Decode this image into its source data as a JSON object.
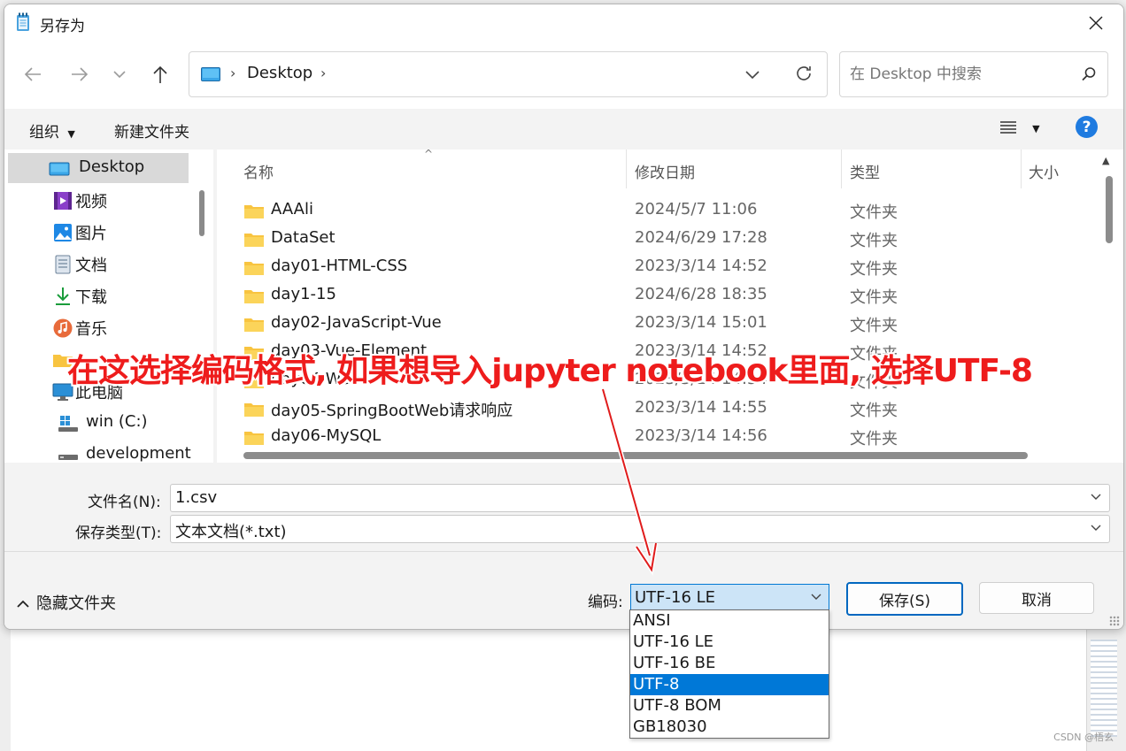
{
  "window": {
    "title": "另存为"
  },
  "nav": {
    "address_segments": [
      "Desktop"
    ],
    "search_placeholder": "在 Desktop 中搜索"
  },
  "toolbar": {
    "organize_label": "组织",
    "new_folder_label": "新建文件夹"
  },
  "sidebar": {
    "items": [
      {
        "label": "Desktop",
        "icon": "desktop-icon"
      },
      {
        "label": "视频",
        "icon": "video-icon"
      },
      {
        "label": "图片",
        "icon": "picture-icon"
      },
      {
        "label": "文档",
        "icon": "document-icon"
      },
      {
        "label": "下载",
        "icon": "download-icon"
      },
      {
        "label": "音乐",
        "icon": "music-icon"
      },
      {
        "label": "此电脑",
        "icon": "computer-icon"
      },
      {
        "label": "win (C:)",
        "icon": "drive-icon"
      },
      {
        "label": "development",
        "icon": "drive-icon"
      }
    ]
  },
  "file_list": {
    "columns": [
      "名称",
      "修改日期",
      "类型",
      "大小"
    ],
    "rows": [
      {
        "name": "AAAli",
        "date": "2024/5/7 11:06",
        "type": "文件夹"
      },
      {
        "name": "DataSet",
        "date": "2024/6/29 17:28",
        "type": "文件夹"
      },
      {
        "name": "day01-HTML-CSS",
        "date": "2023/3/14 14:52",
        "type": "文件夹"
      },
      {
        "name": "day1-15",
        "date": "2024/6/28 18:35",
        "type": "文件夹"
      },
      {
        "name": "day02-JavaScript-Vue",
        "date": "2023/3/14 15:01",
        "type": "文件夹"
      },
      {
        "name": "day03-Vue-Element",
        "date": "2023/3/14 14:52",
        "type": "文件夹"
      },
      {
        "name": "day04-Web",
        "date": "2023/3/14 14:54",
        "type": "文件夹"
      },
      {
        "name": "day05-SpringBootWeb请求响应",
        "date": "2023/3/14 14:55",
        "type": "文件夹"
      },
      {
        "name": "day06-MySQL",
        "date": "2023/3/14 14:56",
        "type": "文件夹"
      }
    ]
  },
  "form": {
    "filename_label": "文件名(N):",
    "filename_value": "1.csv",
    "filetype_label": "保存类型(T):",
    "filetype_value": "文本文档(*.txt)"
  },
  "footer": {
    "hide_folders_label": "隐藏文件夹",
    "encoding_label": "编码:",
    "encoding_value": "UTF-16 LE",
    "save_label": "保存(S)",
    "cancel_label": "取消"
  },
  "encoding_options": [
    "ANSI",
    "UTF-16 LE",
    "UTF-16 BE",
    "UTF-8",
    "UTF-8 BOM",
    "GB18030"
  ],
  "encoding_highlighted": "UTF-8",
  "annotation": {
    "text": "在这选择编码格式, 如果想导入jupyter notebook里面, 选择UTF-8",
    "color": "#ee1c1c"
  },
  "watermark": "CSDN @梧玄",
  "colors": {
    "accent": "#0078d4",
    "selection": "#0078d7",
    "folder": "#f8c440",
    "help": "#1f7be0"
  }
}
